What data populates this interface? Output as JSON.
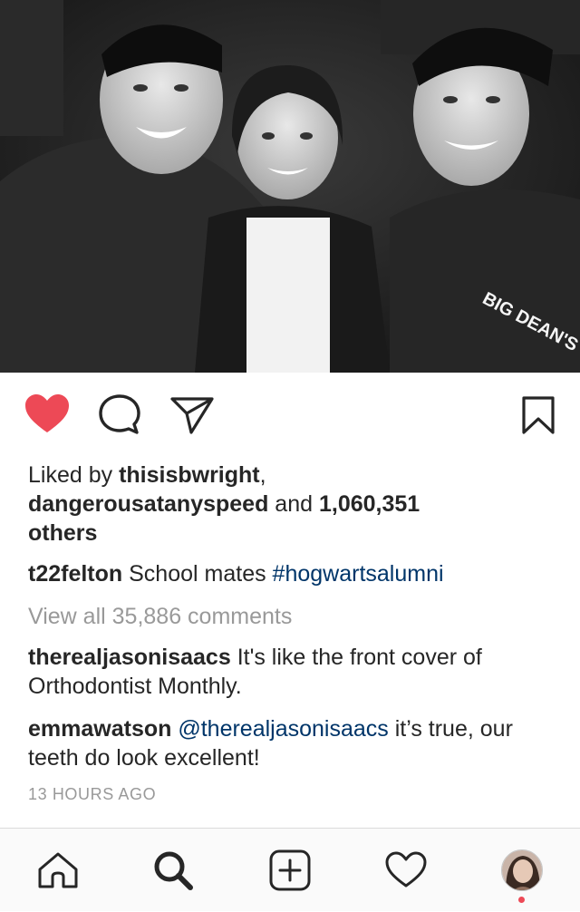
{
  "post": {
    "photo_alt": "black and white photo of three friends smiling",
    "shirt_text": "BIG DEAN'S",
    "likes": {
      "prefix": "Liked by ",
      "user1": "thisisbwright",
      "sep": ",",
      "user2": "dangerousatanyspeed",
      "and": " and ",
      "count": "1,060,351",
      "others": "others"
    },
    "caption": {
      "user": "t22felton",
      "text": " School mates ",
      "hashtag": "#hogwartsalumni"
    },
    "view_all": "View all 35,886 comments",
    "comments": [
      {
        "user": "therealjasonisaacs",
        "text": " It's like the front cover of Orthodontist Monthly."
      },
      {
        "user": "emmawatson",
        "mention": " @therealjasonisaacs",
        "text": " it’s true, our teeth do look excellent!"
      }
    ],
    "timestamp": "13 HOURS AGO"
  },
  "icons": {
    "like": "heart-filled-icon",
    "comment": "speech-bubble-icon",
    "share": "paper-plane-icon",
    "save": "bookmark-icon"
  },
  "tabbar": {
    "items": [
      "home-icon",
      "search-icon",
      "add-post-icon",
      "activity-heart-icon",
      "profile-avatar"
    ]
  },
  "colors": {
    "like": "#ed4956",
    "hashtag": "#003569",
    "muted": "#999999",
    "notification_dot": "#ed4956"
  }
}
